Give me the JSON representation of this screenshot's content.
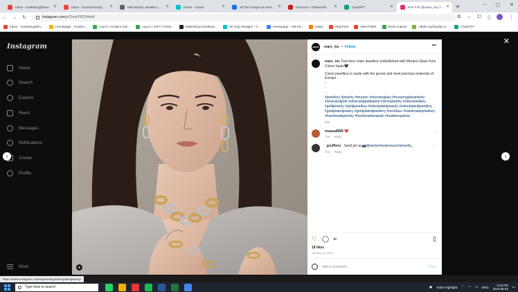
{
  "browser": {
    "tabs": [
      {
        "label": "Inbox - marketing@mur...",
        "color": "#ea4335"
      },
      {
        "label": "Inbox - ecommerce@mur...",
        "color": "#ea4335"
      },
      {
        "label": "Mari Barzai Jewellery Coll...",
        "color": "#5f6368"
      },
      {
        "label": "Home - Canva",
        "color": "#00c4cc"
      },
      {
        "label": "28 Tom Shops we loved a...",
        "color": "#1a73e8"
      },
      {
        "label": "Kimonos + Debenede",
        "color": "#c5221f"
      },
      {
        "label": "ChatGPT",
        "color": "#10a37f"
      },
      {
        "label": "M R A R (@marx_inc) • In...",
        "color": "#e1306c",
        "active": true
      }
    ],
    "new_tab": "+",
    "window_controls": [
      "–",
      "▢",
      "✕"
    ],
    "url_host": "instagram.com",
    "url_path": "/p/CheeXR2OHwA/",
    "bookmarks": [
      {
        "label": "Inbox - marketing@m...",
        "color": "#ea4335"
      },
      {
        "label": "Homepage - Cindy's...",
        "color": "#f4b400"
      },
      {
        "label": "Log In | Cindy's Gar...",
        "color": "#34a853"
      },
      {
        "label": "Log In | GIFT CARD...",
        "color": "#34a853"
      },
      {
        "label": "MailChimp Dashboa...",
        "color": "#222222"
      },
      {
        "label": "All Your Designs - C...",
        "color": "#00c4cc"
      },
      {
        "label": "Homepage - SM Inf...",
        "color": "#4285f4"
      },
      {
        "label": "Gator",
        "color": "#f57c00"
      },
      {
        "label": "ShipTime",
        "color": "#ea4335"
      },
      {
        "label": "WEATHER",
        "color": "#ea4335"
      },
      {
        "label": "Rooh Caprar",
        "color": "#34a853"
      },
      {
        "label": "cibele-mythopify.co...",
        "color": "#7cb342"
      },
      {
        "label": "ChatGPT",
        "color": "#10a37f"
      }
    ]
  },
  "instagram": {
    "logo": "Instagram",
    "nav": [
      "Home",
      "Search",
      "Explore",
      "Reels",
      "Messages",
      "Notifications",
      "Create",
      "Profile"
    ],
    "more": "More",
    "post": {
      "username": "marx_inc",
      "follow": "Follow",
      "avatar_text": "MARX",
      "caption_user": "marx_inc",
      "caption_text": "Two-tone chain jewellery embellished with Murano Glass from Cicion Spain🖤",
      "caption_2": "Cicion jewellery is made with the purest and most precious materials of Europe.",
      "caption_dots": [
        "-",
        "-",
        "-"
      ],
      "hashtags": "#jewellery #jewelry #murano #muranoglass #muranoglassjewelry #silverandgold #silverandgoldplated #silverjewelry #silverjewellery #goldjewelry #goldjewellery #silverplatedjewelry #silverplatedjewellery #goldplatedjewelry #goldplatedjewellery #necklace #handmadejewellery #handmadejewelry #handmadeinspain #madeinspaines",
      "caption_age": "92w",
      "comments": [
        {
          "user": "muasa8956",
          "text": "❤️",
          "age": "71w",
          "reply": "Reply",
          "color": "#b85a3a"
        },
        {
          "user": "_gruffters_",
          "text": "Send pic as📷",
          "mention": "@womenbusinesscommunity_",
          "age": "72w",
          "reply": "Reply",
          "color": "#333333"
        }
      ],
      "likes": "18 likes",
      "date": "January 16, 2022",
      "add_comment": "Add a comment...",
      "post_btn": "Post"
    }
  },
  "status_url": "https://www.instagram.com/explore/tags/silverplatedjewelry/",
  "taskbar": {
    "search_placeholder": "Type here to search",
    "video": "Video highlight",
    "lang": "ENG",
    "time": "5:18 PM",
    "date": "2024-06-03"
  }
}
